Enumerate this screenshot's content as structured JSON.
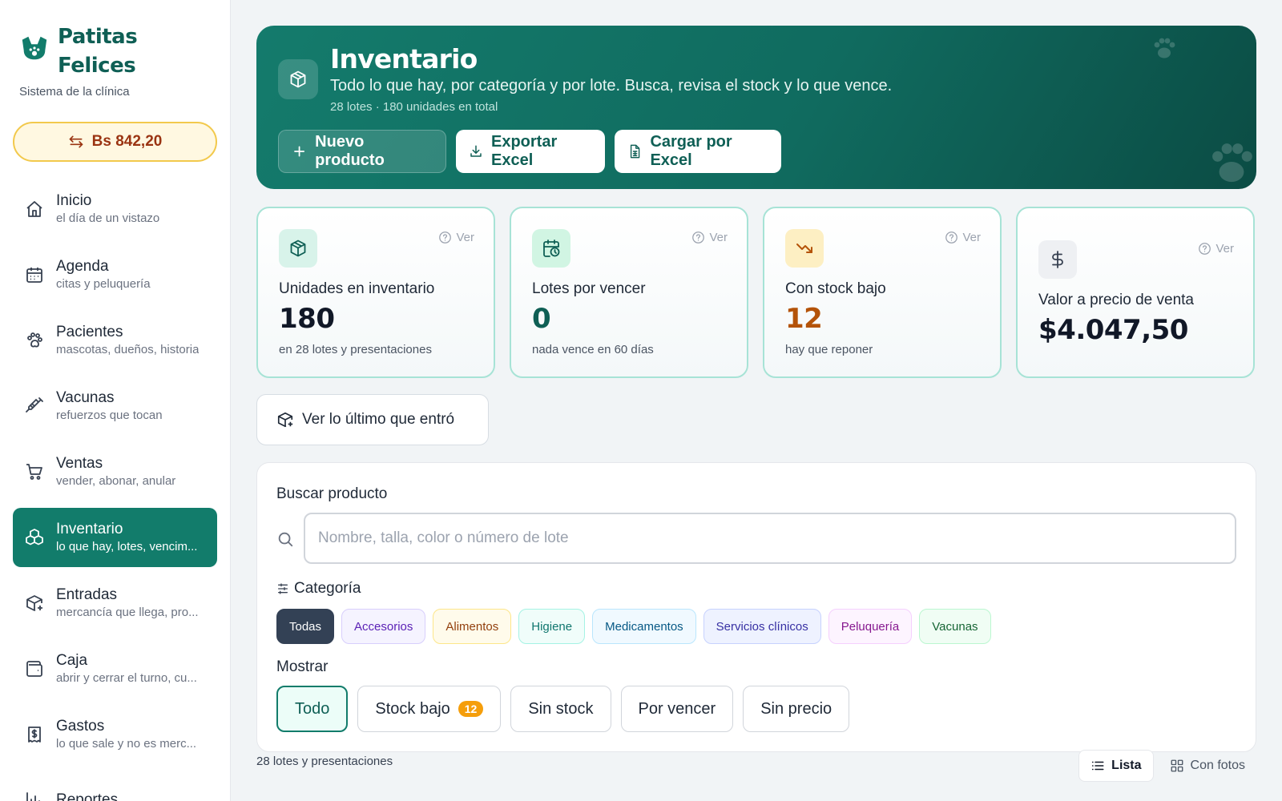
{
  "brand": {
    "name_line1": "Patitas",
    "name_line2": "Felices",
    "subtitle": "Sistema de la clínica",
    "logo_icon": "dog-logo-icon"
  },
  "exchange": {
    "label": "Bs 842,20",
    "icon": "swap-icon"
  },
  "nav": [
    {
      "title": "Inicio",
      "sub": "el día de un vistazo",
      "icon": "home-icon"
    },
    {
      "title": "Agenda",
      "sub": "citas y peluquería",
      "icon": "calendar-icon"
    },
    {
      "title": "Pacientes",
      "sub": "mascotas, dueños, historia",
      "icon": "paw-icon"
    },
    {
      "title": "Vacunas",
      "sub": "refuerzos que tocan",
      "icon": "syringe-icon"
    },
    {
      "title": "Ventas",
      "sub": "vender, abonar, anular",
      "icon": "cart-icon"
    },
    {
      "title": "Inventario",
      "sub": "lo que hay, lotes, vencim...",
      "icon": "boxes-icon",
      "active": true
    },
    {
      "title": "Entradas",
      "sub": "mercancía que llega, pro...",
      "icon": "package-plus-icon"
    },
    {
      "title": "Caja",
      "sub": "abrir y cerrar el turno, cu...",
      "icon": "wallet-icon"
    },
    {
      "title": "Gastos",
      "sub": "lo que sale y no es merc...",
      "icon": "receipt-icon"
    },
    {
      "title": "Reportes",
      "sub": "",
      "icon": "chart-icon"
    }
  ],
  "hero": {
    "title": "Inventario",
    "description": "Todo lo que hay, por categoría y por lote. Busca, revisa el stock y lo que vence.",
    "meta": "28 lotes · 180 unidades en total",
    "actions": {
      "new_product": "Nuevo producto",
      "export": "Exportar Excel",
      "import": "Cargar por Excel"
    }
  },
  "stats": [
    {
      "label": "Unidades en inventario",
      "value": "180",
      "sub": "en 28 lotes y presentaciones",
      "ver": "Ver",
      "icon": "box-icon",
      "color": "#111827",
      "icon_bg": "#d8f3ea",
      "icon_color": "#0f5f55"
    },
    {
      "label": "Lotes por vencer",
      "value": "0",
      "sub": "nada vence en 60 días",
      "ver": "Ver",
      "icon": "calendar-clock-icon",
      "color": "#0f5f55",
      "icon_bg": "#d1f5e3",
      "icon_color": "#0f5f55"
    },
    {
      "label": "Con stock bajo",
      "value": "12",
      "sub": "hay que reponer",
      "ver": "Ver",
      "icon": "trending-down-icon",
      "color": "#b45309",
      "icon_bg": "#fdefc3",
      "icon_color": "#b45309"
    },
    {
      "label": "Valor a precio de venta",
      "value": "$4.047,50",
      "sub": "",
      "ver": "Ver",
      "icon": "dollar-icon",
      "color": "#111827",
      "icon_bg": "#eef0f3",
      "icon_color": "#374151"
    }
  ],
  "last_entry_button": "Ver lo último que entró",
  "filters": {
    "search_label": "Buscar producto",
    "search_placeholder": "Nombre, talla, color o número de lote",
    "search_value": "",
    "category_label": "Categoría",
    "categories": [
      {
        "label": "Todas",
        "bg": "#334155",
        "border": "#334155",
        "color": "#ffffff"
      },
      {
        "label": "Accesorios",
        "bg": "#f5f3ff",
        "border": "#d8cffc",
        "color": "#5b21b6"
      },
      {
        "label": "Alimentos",
        "bg": "#fffbeb",
        "border": "#fde68a",
        "color": "#92400e"
      },
      {
        "label": "Higiene",
        "bg": "#f0fdfa",
        "border": "#a5f3e4",
        "color": "#0f766e"
      },
      {
        "label": "Medicamentos",
        "bg": "#f0f9ff",
        "border": "#bae6fd",
        "color": "#075985"
      },
      {
        "label": "Servicios clínicos",
        "bg": "#eef2ff",
        "border": "#c7d2fe",
        "color": "#3730a3"
      },
      {
        "label": "Peluquería",
        "bg": "#fdf4ff",
        "border": "#f5d0fe",
        "color": "#86198f"
      },
      {
        "label": "Vacunas",
        "bg": "#f0fdf4",
        "border": "#bbf7d0",
        "color": "#166534"
      }
    ],
    "show_label": "Mostrar",
    "show_options": [
      {
        "label": "Todo",
        "active": true
      },
      {
        "label": "Stock bajo",
        "badge": "12"
      },
      {
        "label": "Sin stock"
      },
      {
        "label": "Por vencer"
      },
      {
        "label": "Sin precio"
      }
    ]
  },
  "results": {
    "count_text": "28 lotes y presentaciones",
    "view_list": "Lista",
    "view_photos": "Con fotos",
    "view_selected": "Lista"
  },
  "colors": {
    "primary": "#127c6b",
    "warning": "#f59e0b",
    "accent_border": "#a7e3d6"
  }
}
